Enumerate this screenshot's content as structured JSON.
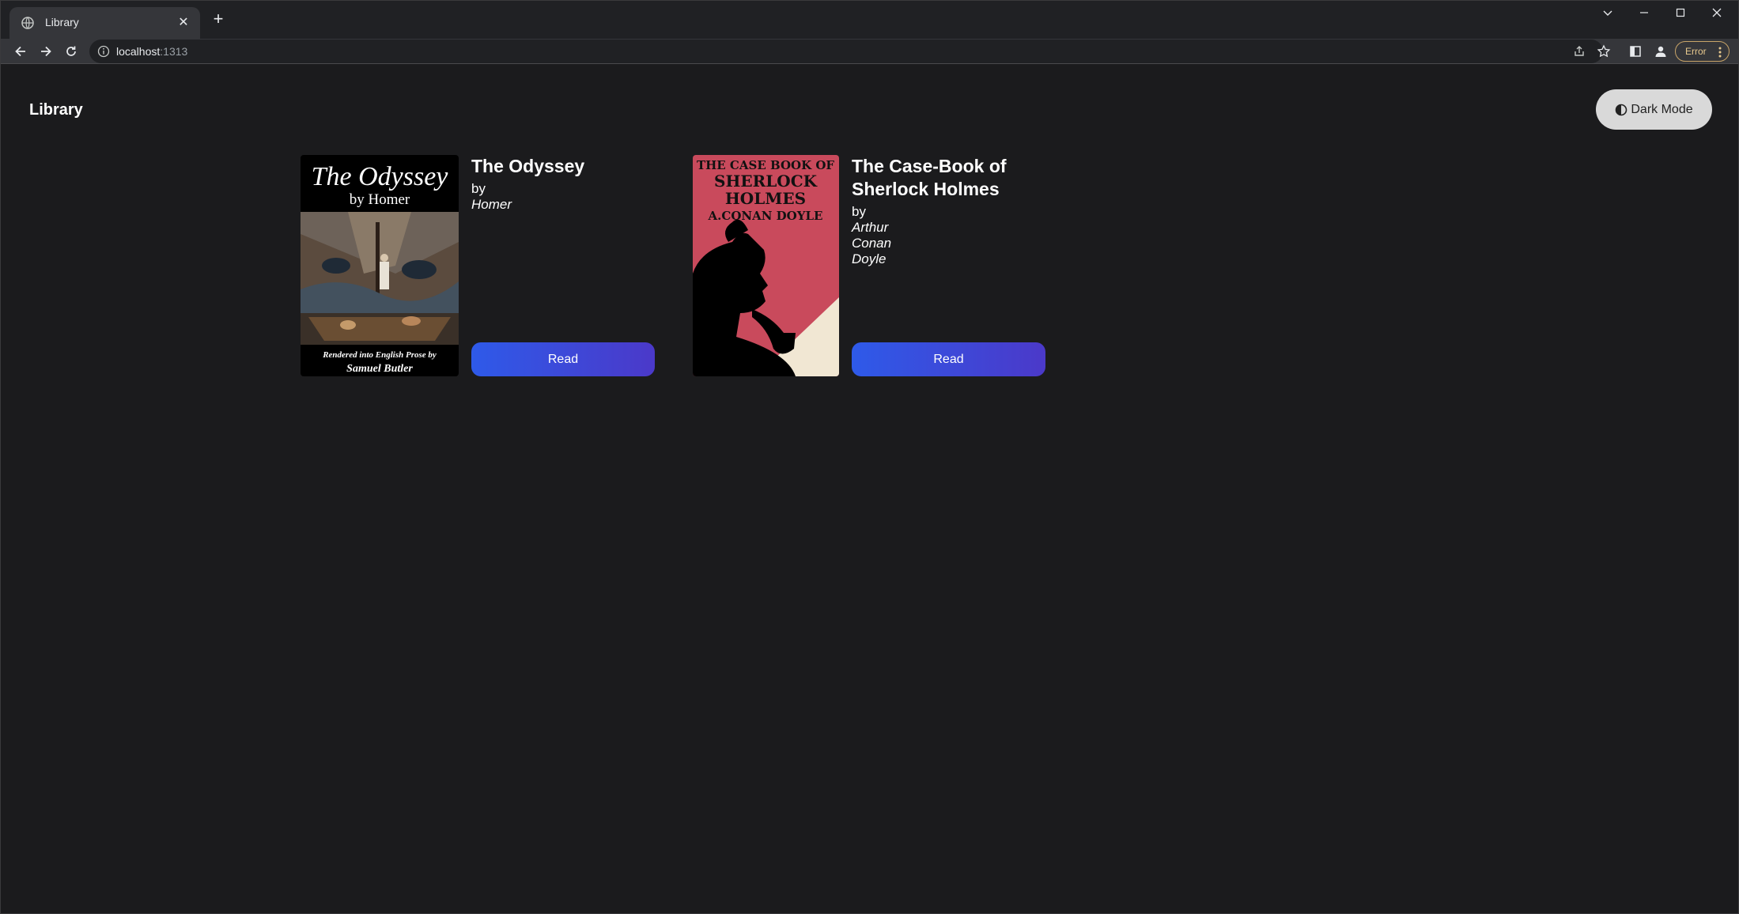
{
  "browser": {
    "tab_title": "Library",
    "url_host": "localhost",
    "url_port": ":1313",
    "error_label": "Error"
  },
  "site": {
    "title": "Library",
    "theme_toggle_label": "Dark Mode"
  },
  "books": [
    {
      "title": "The Odyssey",
      "by": "by",
      "author": "Homer",
      "read_label": "Read",
      "cover": {
        "title_line": "The Odyssey",
        "byline": "by Homer",
        "credit_line_1": "Rendered into English Prose by",
        "credit_line_2": "Samuel Butler"
      }
    },
    {
      "title": "The Case-Book of Sherlock Holmes",
      "by": "by",
      "author": "Arthur Conan Doyle",
      "read_label": "Read",
      "cover": {
        "line_1": "THE CASE BOOK OF",
        "line_2": "SHERLOCK",
        "line_3": "HOLMES",
        "line_4": "A.CONAN DOYLE"
      }
    }
  ]
}
